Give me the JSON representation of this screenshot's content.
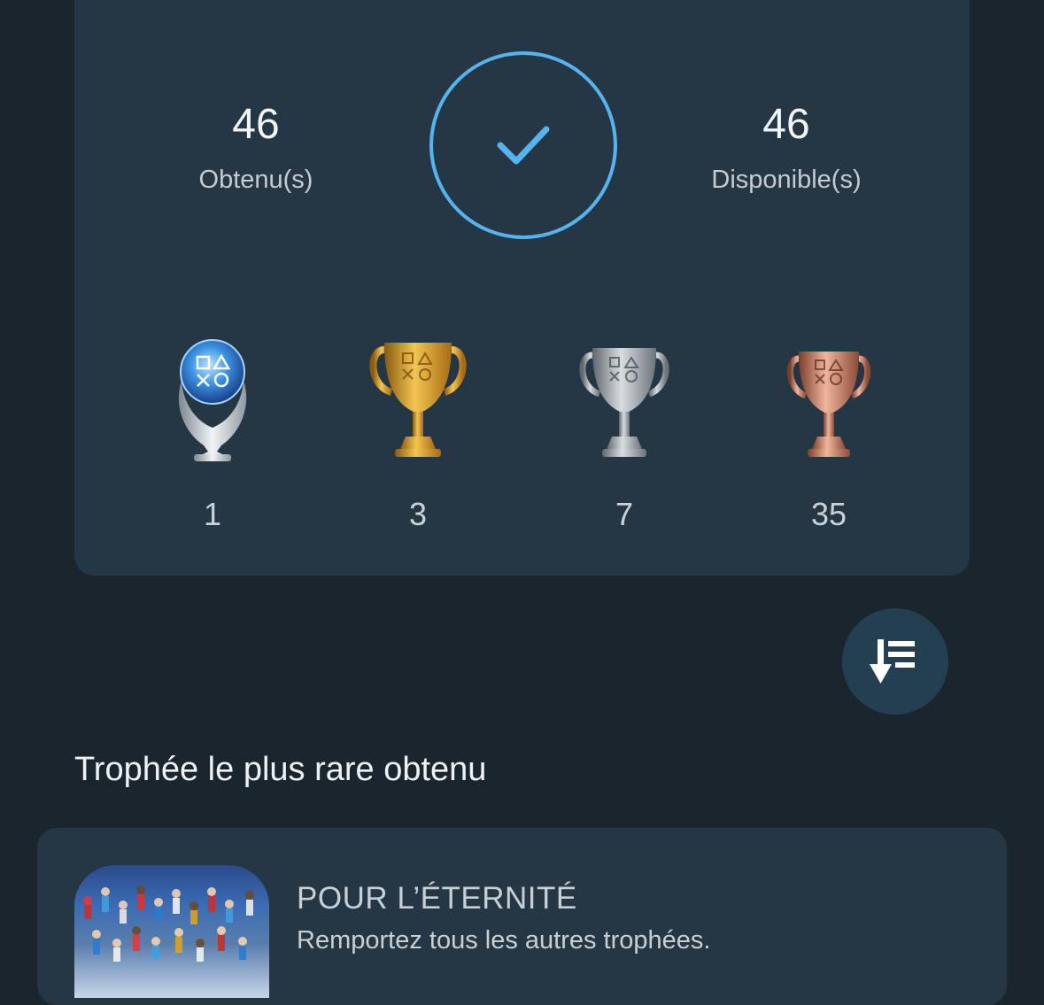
{
  "summary": {
    "earned": {
      "value": "46",
      "label": "Obtenu(s)"
    },
    "available": {
      "value": "46",
      "label": "Disponible(s)"
    },
    "completion_icon": "checkmark-icon",
    "accent_color": "#55b4ef"
  },
  "trophies": [
    {
      "type": "platinum",
      "icon": "platinum-trophy-icon",
      "count": "1"
    },
    {
      "type": "gold",
      "icon": "gold-trophy-icon",
      "count": "3"
    },
    {
      "type": "silver",
      "icon": "silver-trophy-icon",
      "count": "7"
    },
    {
      "type": "bronze",
      "icon": "bronze-trophy-icon",
      "count": "35"
    }
  ],
  "sort_button": {
    "icon": "sort-descending-icon"
  },
  "rarest_section": {
    "title": "Trophée le plus rare obtenu",
    "trophy": {
      "name": "POUR L’ÉTERNITÉ",
      "description": "Remportez tous les autres trophées."
    }
  }
}
